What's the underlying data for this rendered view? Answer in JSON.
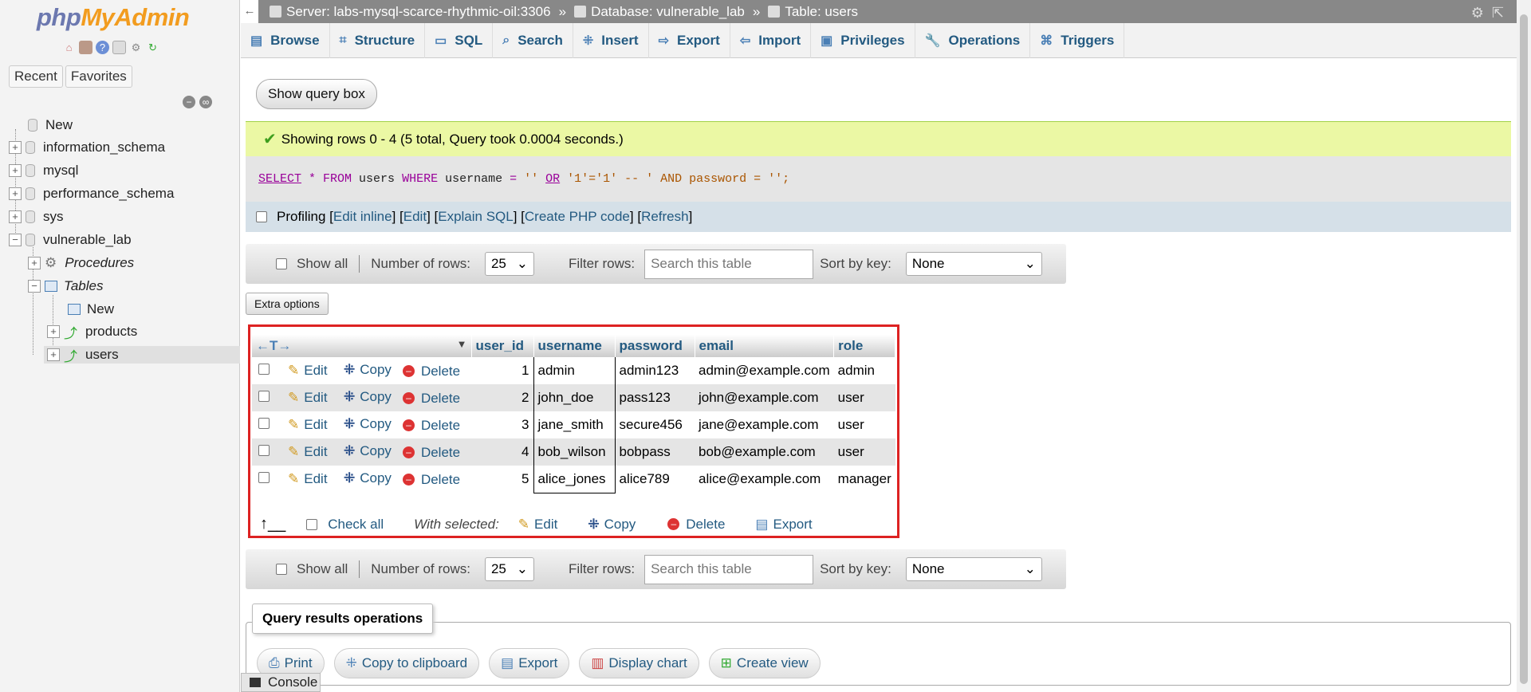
{
  "logo": {
    "php": "php",
    "myadmin": "MyAdmin"
  },
  "left": {
    "recent": "Recent",
    "favorites": "Favorites",
    "tree": {
      "new": "New",
      "information_schema": "information_schema",
      "mysql": "mysql",
      "performance_schema": "performance_schema",
      "sys": "sys",
      "vulnerable_lab": "vulnerable_lab",
      "procedures": "Procedures",
      "tables": "Tables",
      "tables_new": "New",
      "products": "products",
      "users": "users"
    }
  },
  "breadcrumb": {
    "server": "Server: labs-mysql-scarce-rhythmic-oil:3306",
    "database": "Database: vulnerable_lab",
    "table": "Table: users",
    "sep": "»"
  },
  "tabs": [
    "Browse",
    "Structure",
    "SQL",
    "Search",
    "Insert",
    "Export",
    "Import",
    "Privileges",
    "Operations",
    "Triggers"
  ],
  "show_query_box": "Show query box",
  "success_message": "Showing rows 0 - 4 (5 total, Query took 0.0004 seconds.)",
  "query": {
    "select": "SELECT",
    "star": " * ",
    "from": "FROM",
    "t1": " users ",
    "where": "WHERE",
    "t2": " username ",
    "eq": "=",
    "s1": " '' ",
    "or": "OR",
    "s2": " '1'='1' -- ' AND password = '';"
  },
  "profiling": {
    "label": "Profiling",
    "links": [
      "Edit inline",
      "Edit",
      "Explain SQL",
      "Create PHP code",
      "Refresh"
    ]
  },
  "nav": {
    "show_all": "Show all",
    "num_rows_label": "Number of rows:",
    "num_rows_value": "25",
    "filter_label": "Filter rows:",
    "filter_placeholder": "Search this table",
    "sort_label": "Sort by key:",
    "sort_value": "None"
  },
  "extra_options": "Extra options",
  "table": {
    "columns": [
      "user_id",
      "username",
      "password",
      "email",
      "role"
    ],
    "action_labels": {
      "edit": "Edit",
      "copy": "Copy",
      "delete": "Delete"
    },
    "rows": [
      {
        "user_id": "1",
        "username": "admin",
        "password": "admin123",
        "email": "admin@example.com",
        "role": "admin"
      },
      {
        "user_id": "2",
        "username": "john_doe",
        "password": "pass123",
        "email": "john@example.com",
        "role": "user"
      },
      {
        "user_id": "3",
        "username": "jane_smith",
        "password": "secure456",
        "email": "jane@example.com",
        "role": "user"
      },
      {
        "user_id": "4",
        "username": "bob_wilson",
        "password": "bobpass",
        "email": "bob@example.com",
        "role": "user"
      },
      {
        "user_id": "5",
        "username": "alice_jones",
        "password": "alice789",
        "email": "alice@example.com",
        "role": "manager"
      }
    ]
  },
  "bulk": {
    "check_all": "Check all",
    "with_selected": "With selected:",
    "edit": "Edit",
    "copy": "Copy",
    "delete": "Delete",
    "export": "Export"
  },
  "qro": {
    "legend": "Query results operations",
    "actions": [
      "Print",
      "Copy to clipboard",
      "Export",
      "Display chart",
      "Create view"
    ]
  },
  "console": "Console",
  "colors": {
    "accent": "#235a81",
    "success_bg": "#ebf8a4",
    "highlight_border": "#dd2222"
  }
}
